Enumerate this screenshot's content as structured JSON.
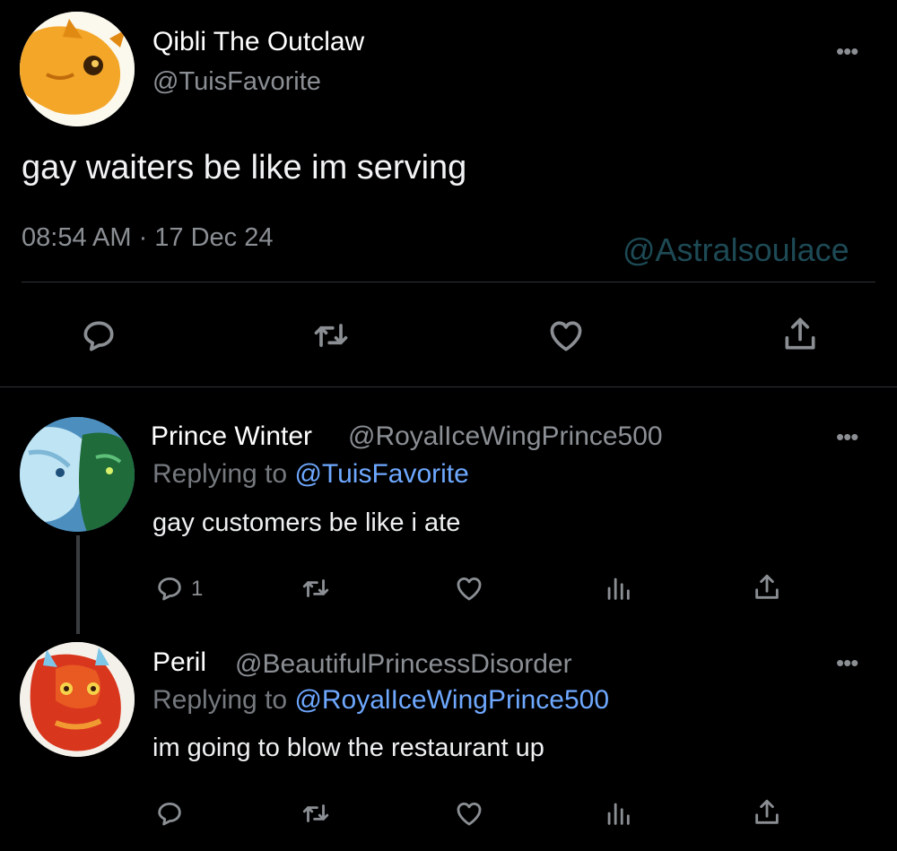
{
  "main_tweet": {
    "display_name": "Qibli The Outclaw",
    "handle": "@TuisFavorite",
    "text": "gay waiters be like im serving",
    "timestamp": "08:54 AM · 17 Dec 24",
    "watermark": "@Astralsoulace",
    "more_label": "•••"
  },
  "replies": [
    {
      "display_name": "Prince Winter",
      "handle": "@RoyalIceWingPrince500",
      "replying_prefix": "Replying to",
      "replying_to": "@TuisFavorite",
      "text": "gay customers be like i ate",
      "reply_count": "1",
      "more_label": "•••"
    },
    {
      "display_name": "Peril",
      "handle": "@BeautifulPrincessDisorder",
      "replying_prefix": "Replying to",
      "replying_to": "@RoyalIceWingPrince500",
      "text": "im going to blow the restaurant up",
      "reply_count": "",
      "more_label": "•••"
    }
  ],
  "colors": {
    "background": "#000000",
    "muted": "#8b8f94",
    "link": "#6ea8ff",
    "watermark": "#1d4a55",
    "divider": "#2f3336"
  },
  "icons": [
    "reply-icon",
    "retweet-icon",
    "like-icon",
    "share-icon",
    "analytics-icon",
    "more-icon"
  ]
}
